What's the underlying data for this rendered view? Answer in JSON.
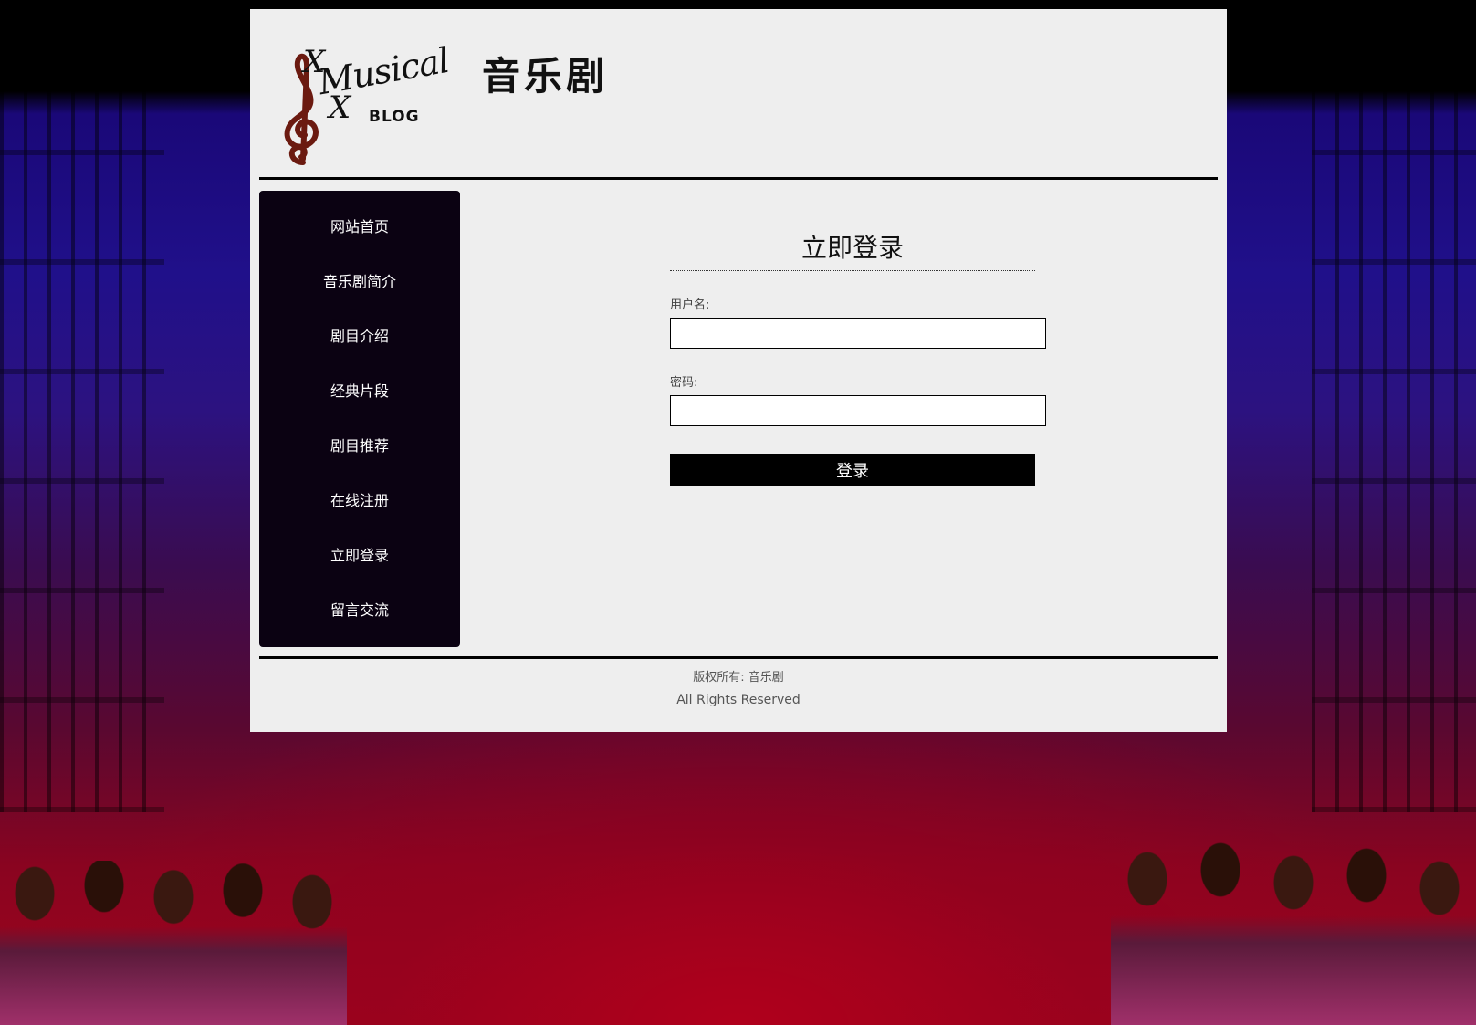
{
  "header": {
    "site_title": "音乐剧",
    "logo": {
      "word": "Musical",
      "letter_x": "X",
      "blog": "BLOG",
      "clef_color": "#6b1a10"
    }
  },
  "sidebar": {
    "items": [
      {
        "label": "网站首页"
      },
      {
        "label": "音乐剧简介"
      },
      {
        "label": "剧目介绍"
      },
      {
        "label": "经典片段"
      },
      {
        "label": "剧目推荐"
      },
      {
        "label": "在线注册"
      },
      {
        "label": "立即登录"
      },
      {
        "label": "留言交流"
      }
    ]
  },
  "login": {
    "title": "立即登录",
    "username_label": "用户名:",
    "username_value": "",
    "password_label": "密码:",
    "password_value": "",
    "submit_label": "登录"
  },
  "footer": {
    "copyright": "版权所有: 音乐剧",
    "rights": "All Rights Reserved"
  },
  "colors": {
    "panel_bg": "#eeeeee",
    "sidebar_bg": "#0b0212",
    "button_bg": "#000000"
  }
}
